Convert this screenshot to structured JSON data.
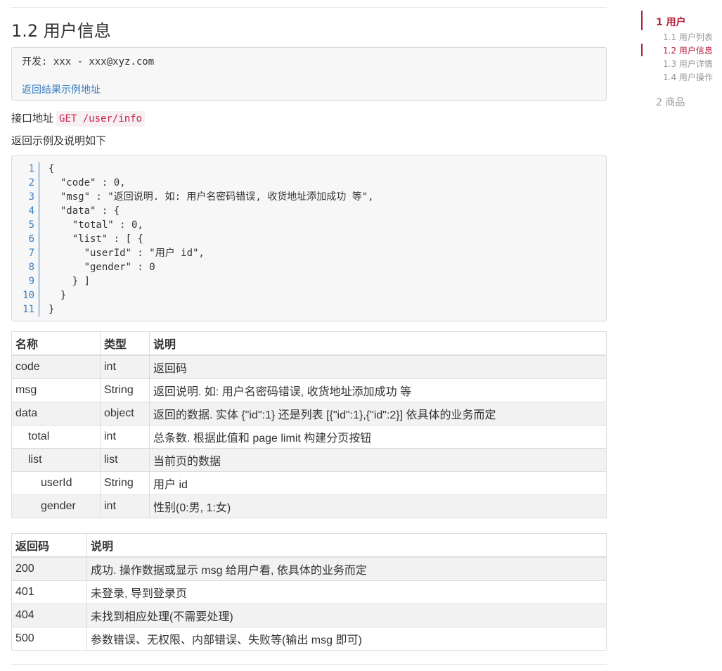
{
  "page": {
    "title": "1.2 用户信息"
  },
  "dev_box": {
    "developer_line": "开发: xxx - xxx@xyz.com",
    "example_link": "返回结果示例地址"
  },
  "api": {
    "label": "接口地址",
    "endpoint": "GET /user/info"
  },
  "description": "返回示例及说明如下",
  "code_block": {
    "line_numbers": [
      "1",
      "2",
      "3",
      "4",
      "5",
      "6",
      "7",
      "8",
      "9",
      "10",
      "11"
    ],
    "lines": [
      "{",
      "  \"code\" : 0,",
      "  \"msg\" : \"返回说明. 如: 用户名密码错误, 收货地址添加成功 等\",",
      "  \"data\" : {",
      "    \"total\" : 0,",
      "    \"list\" : [ {",
      "      \"userId\" : \"用户 id\",",
      "      \"gender\" : 0",
      "    } ]",
      "  }",
      "}"
    ]
  },
  "fields_table": {
    "headers": [
      "名称",
      "类型",
      "说明"
    ],
    "rows": [
      {
        "name": "code",
        "type": "int",
        "desc": "返回码"
      },
      {
        "name": "msg",
        "type": "String",
        "desc": "返回说明. 如: 用户名密码错误, 收货地址添加成功 等"
      },
      {
        "name": "data",
        "type": "object",
        "desc": "返回的数据. 实体 {\"id\":1} 还是列表 [{\"id\":1},{\"id\":2}] 依具体的业务而定"
      },
      {
        "name": "total",
        "type": "int",
        "desc": "总条数. 根据此值和 page limit 构建分页按钮"
      },
      {
        "name": "list",
        "type": "list",
        "desc": "当前页的数据"
      },
      {
        "name": "userId",
        "type": "String",
        "desc": "用户 id"
      },
      {
        "name": "gender",
        "type": "int",
        "desc": "性别(0:男, 1:女)"
      }
    ]
  },
  "codes_table": {
    "headers": [
      "返回码",
      "说明"
    ],
    "rows": [
      {
        "code": "200",
        "desc": "成功. 操作数据或显示 msg 给用户看, 依具体的业务而定"
      },
      {
        "code": "401",
        "desc": "未登录, 导到登录页"
      },
      {
        "code": "404",
        "desc": "未找到相应处理(不需要处理)"
      },
      {
        "code": "500",
        "desc": "参数错误、无权限、内部错误、失败等(输出 msg 即可)"
      }
    ]
  },
  "toc": {
    "items": [
      {
        "label": "1 用户"
      },
      {
        "label": "1.1 用户列表"
      },
      {
        "label": "1.2 用户信息"
      },
      {
        "label": "1.3 用户详情"
      },
      {
        "label": "1.4 用户操作"
      },
      {
        "label": "2 商品"
      }
    ]
  },
  "colors": {
    "accent": "#b3213a",
    "link": "#3a7ec2",
    "inline_code": "#c7254e"
  }
}
